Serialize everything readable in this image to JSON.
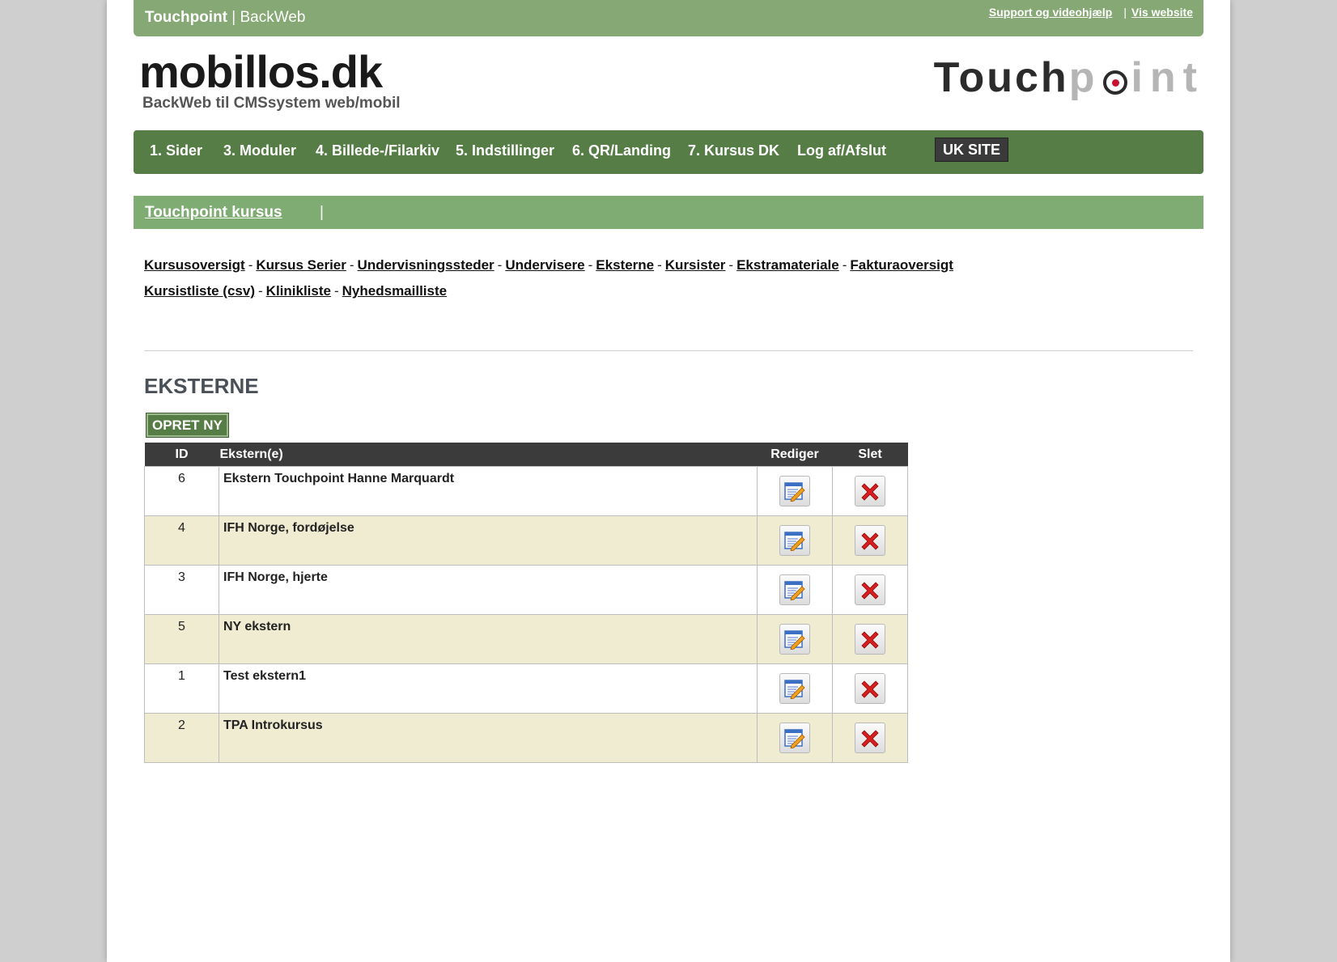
{
  "topbar": {
    "brand_bold": "Touchpoint",
    "brand_rest": " | BackWeb",
    "support_link": "Support og videohjælp",
    "separator": "|",
    "website_link": "Vis website"
  },
  "logo": {
    "title": "mobillos.dk",
    "subtitle": "BackWeb til CMSsystem web/mobil",
    "right_dark": "Touch",
    "right_p": "p",
    "right_grey": "int"
  },
  "mainnav": {
    "items": [
      "1. Sider",
      "3. Moduler",
      "4. Billede-/Filarkiv",
      "5. Indstillinger",
      "6. QR/Landing",
      "7. Kursus DK",
      "Log af/Afslut"
    ],
    "uk": "UK SITE"
  },
  "section": {
    "link": "Touchpoint kursus",
    "pipe": "|"
  },
  "sublinks": {
    "row1": [
      "Kursusoversigt",
      "Kursus Serier",
      "Undervisningssteder",
      "Undervisere",
      "Eksterne",
      "Kursister",
      "Ekstramateriale",
      "Fakturaoversigt"
    ],
    "row2": [
      "Kursistliste (csv)",
      "Klinikliste",
      "Nyhedsmailliste"
    ],
    "dash": "-"
  },
  "page": {
    "title": "EKSTERNE",
    "new_button": "OPRET NY"
  },
  "table": {
    "headers": {
      "id": "ID",
      "name": "Ekstern(e)",
      "edit": "Rediger",
      "delete": "Slet"
    },
    "rows": [
      {
        "id": "6",
        "name": "Ekstern Touchpoint Hanne Marquardt"
      },
      {
        "id": "4",
        "name": "IFH Norge, fordøjelse"
      },
      {
        "id": "3",
        "name": "IFH Norge, hjerte"
      },
      {
        "id": "5",
        "name": "NY ekstern"
      },
      {
        "id": "1",
        "name": "Test ekstern1"
      },
      {
        "id": "2",
        "name": "TPA Introkursus"
      }
    ]
  },
  "colors": {
    "topbar": "#86a874",
    "nav": "#567d46",
    "section": "#7fac73",
    "row_alt": "#f0ecd2",
    "header": "#3b3b3b"
  }
}
